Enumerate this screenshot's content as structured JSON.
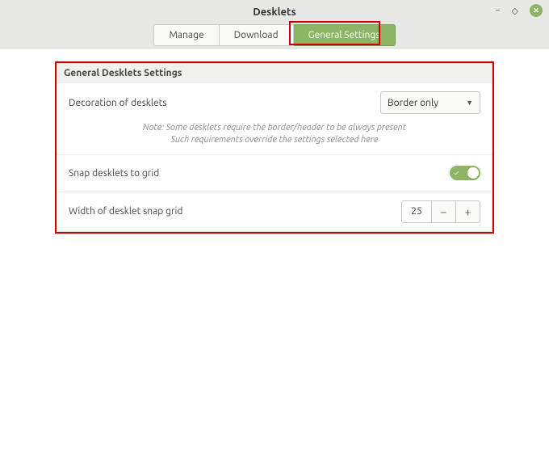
{
  "window": {
    "title": "Desklets"
  },
  "tabs": {
    "manage": "Manage",
    "download": "Download",
    "general": "General Settings"
  },
  "panel": {
    "title": "General Desklets Settings",
    "decoration": {
      "label": "Decoration of desklets",
      "value": "Border only"
    },
    "note_line1": "Note: Some desklets require the border/header to be always present",
    "note_line2": "Such requirements override the settings selected here",
    "snap": {
      "label": "Snap desklets to grid",
      "on": true
    },
    "width": {
      "label": "Width of desklet snap grid",
      "value": "25",
      "minus": "−",
      "plus": "+"
    }
  }
}
